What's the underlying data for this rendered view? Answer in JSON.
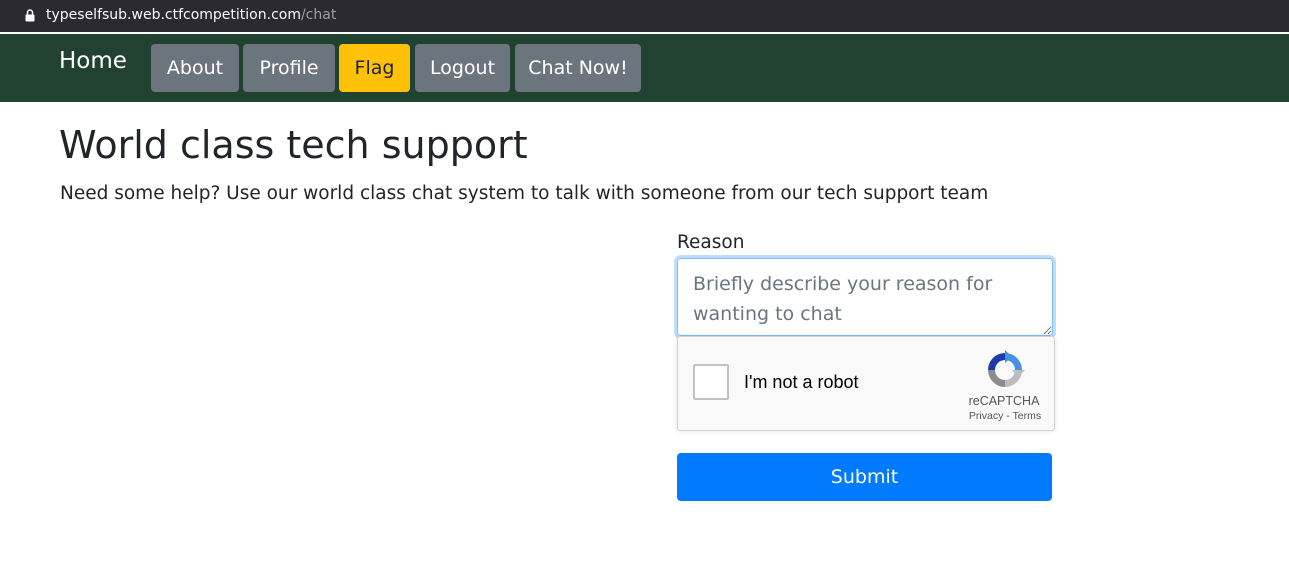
{
  "browser": {
    "url_host": "typeselfsub.web.ctfcompetition.com",
    "url_path": "/chat"
  },
  "navbar": {
    "brand": "Home",
    "items": [
      {
        "label": "About",
        "style": "secondary"
      },
      {
        "label": "Profile",
        "style": "secondary"
      },
      {
        "label": "Flag",
        "style": "warning"
      },
      {
        "label": "Logout",
        "style": "secondary"
      },
      {
        "label": "Chat Now!",
        "style": "secondary"
      }
    ],
    "background": "#214231"
  },
  "main": {
    "title": "World class tech support",
    "lead": "Need some help? Use our world class chat system to talk with someone from our tech support team"
  },
  "form": {
    "reason_label": "Reason",
    "reason_placeholder": "Briefly describe your reason for wanting to chat",
    "reason_value": "",
    "captcha": {
      "label": "I'm not a robot",
      "brand": "reCAPTCHA",
      "privacy": "Privacy",
      "separator": " - ",
      "terms": "Terms",
      "checked": false
    },
    "submit_label": "Submit"
  },
  "colors": {
    "primary": "#007bff",
    "secondary": "#6c757d",
    "warning": "#ffc107"
  },
  "icons": [
    "lock-icon",
    "recaptcha-logo-icon"
  ]
}
